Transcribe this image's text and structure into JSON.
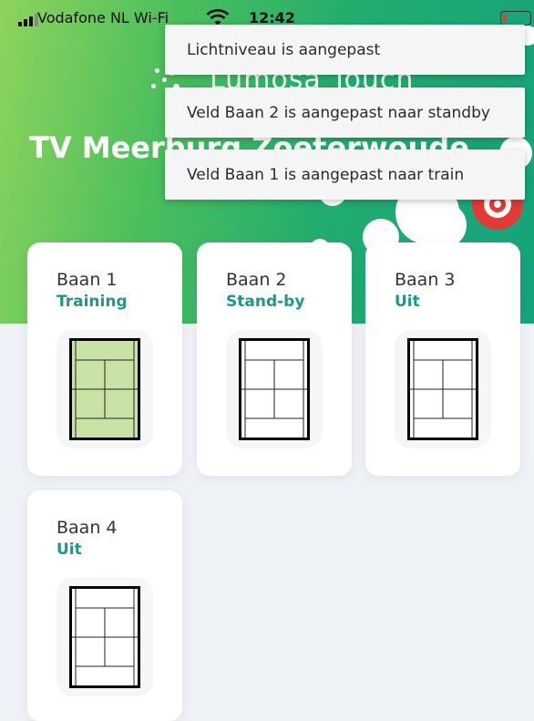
{
  "status_bar": {
    "carrier": "Vodafone NL Wi-Fi",
    "time": "12:42",
    "wifi_icon": "wifi-icon",
    "battery_level": "low"
  },
  "header": {
    "brand": "Lumosa Touch",
    "club_name": "TV Meerburg Zoeterwoude"
  },
  "toasts": [
    {
      "message": "Lichtniveau is aangepast"
    },
    {
      "message": "Veld Baan 2 is aangepast naar standby"
    },
    {
      "message": "Veld Baan 1 is aangepast naar train"
    }
  ],
  "courts": [
    {
      "name": "Baan 1",
      "status": "Training",
      "active": true
    },
    {
      "name": "Baan 2",
      "status": "Stand-by",
      "active": false
    },
    {
      "name": "Baan 3",
      "status": "Uit",
      "active": false
    },
    {
      "name": "Baan 4",
      "status": "Uit",
      "active": false
    }
  ],
  "colors": {
    "accent_teal": "#1a9a86",
    "court_active_fill": "#c9e3a6",
    "header_green": "#4cbf5c",
    "target_red": "#e53935"
  }
}
